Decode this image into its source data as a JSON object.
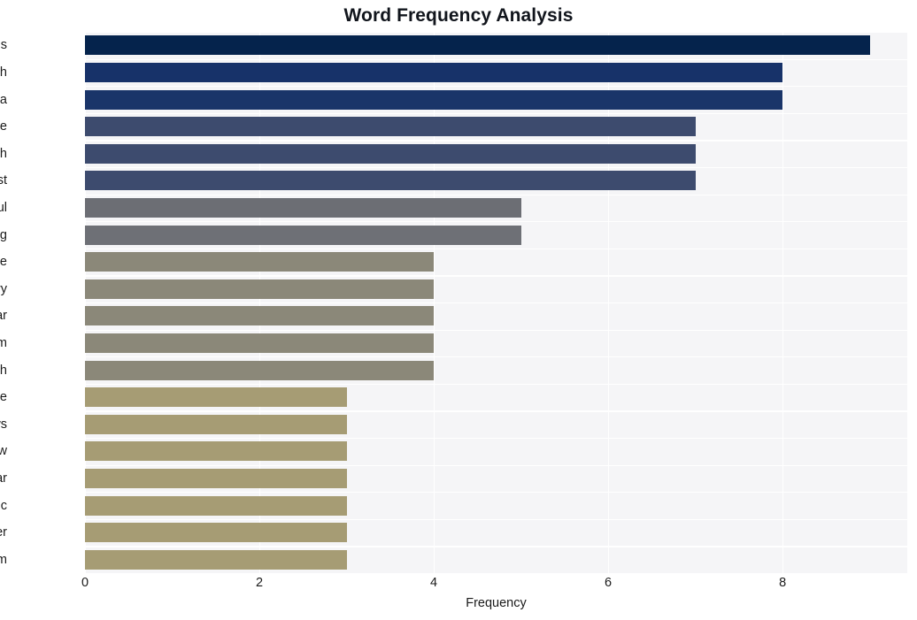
{
  "chart_data": {
    "type": "bar",
    "orientation": "horizontal",
    "title": "Word Frequency Analysis",
    "xlabel": "Frequency",
    "ylabel": "",
    "categories": [
      "missiles",
      "north",
      "korea",
      "cruise",
      "south",
      "test",
      "seoul",
      "pyongyang",
      "fire",
      "military",
      "nuclear",
      "arm",
      "launch",
      "missile",
      "news",
      "new",
      "year",
      "ballistic",
      "border",
      "kim"
    ],
    "values": [
      9,
      8,
      8,
      7,
      7,
      7,
      5,
      5,
      4,
      4,
      4,
      4,
      4,
      3,
      3,
      3,
      3,
      3,
      3,
      3
    ],
    "bar_colors": [
      "#05234c",
      "#173269",
      "#1a3569",
      "#3d4b6e",
      "#3d4b6e",
      "#3d4b6e",
      "#6c6e74",
      "#6e7076",
      "#8b8879",
      "#8b8879",
      "#8b8879",
      "#8b8879",
      "#8b8879",
      "#a69c74",
      "#a69c74",
      "#a69c74",
      "#a69c74",
      "#a69c74",
      "#a69c74",
      "#a69c74"
    ],
    "xlim": [
      0,
      9.43
    ],
    "xticks": [
      0,
      2,
      4,
      6,
      8
    ],
    "xtick_labels": [
      "0",
      "2",
      "4",
      "6",
      "8"
    ],
    "grid": true,
    "grid_color": "#ffffff",
    "plot_background": "#f5f5f7",
    "figure_background": "#ffffff",
    "legend": null,
    "title_color": "#11151c",
    "tick_label_color": "#1a1a1a"
  }
}
